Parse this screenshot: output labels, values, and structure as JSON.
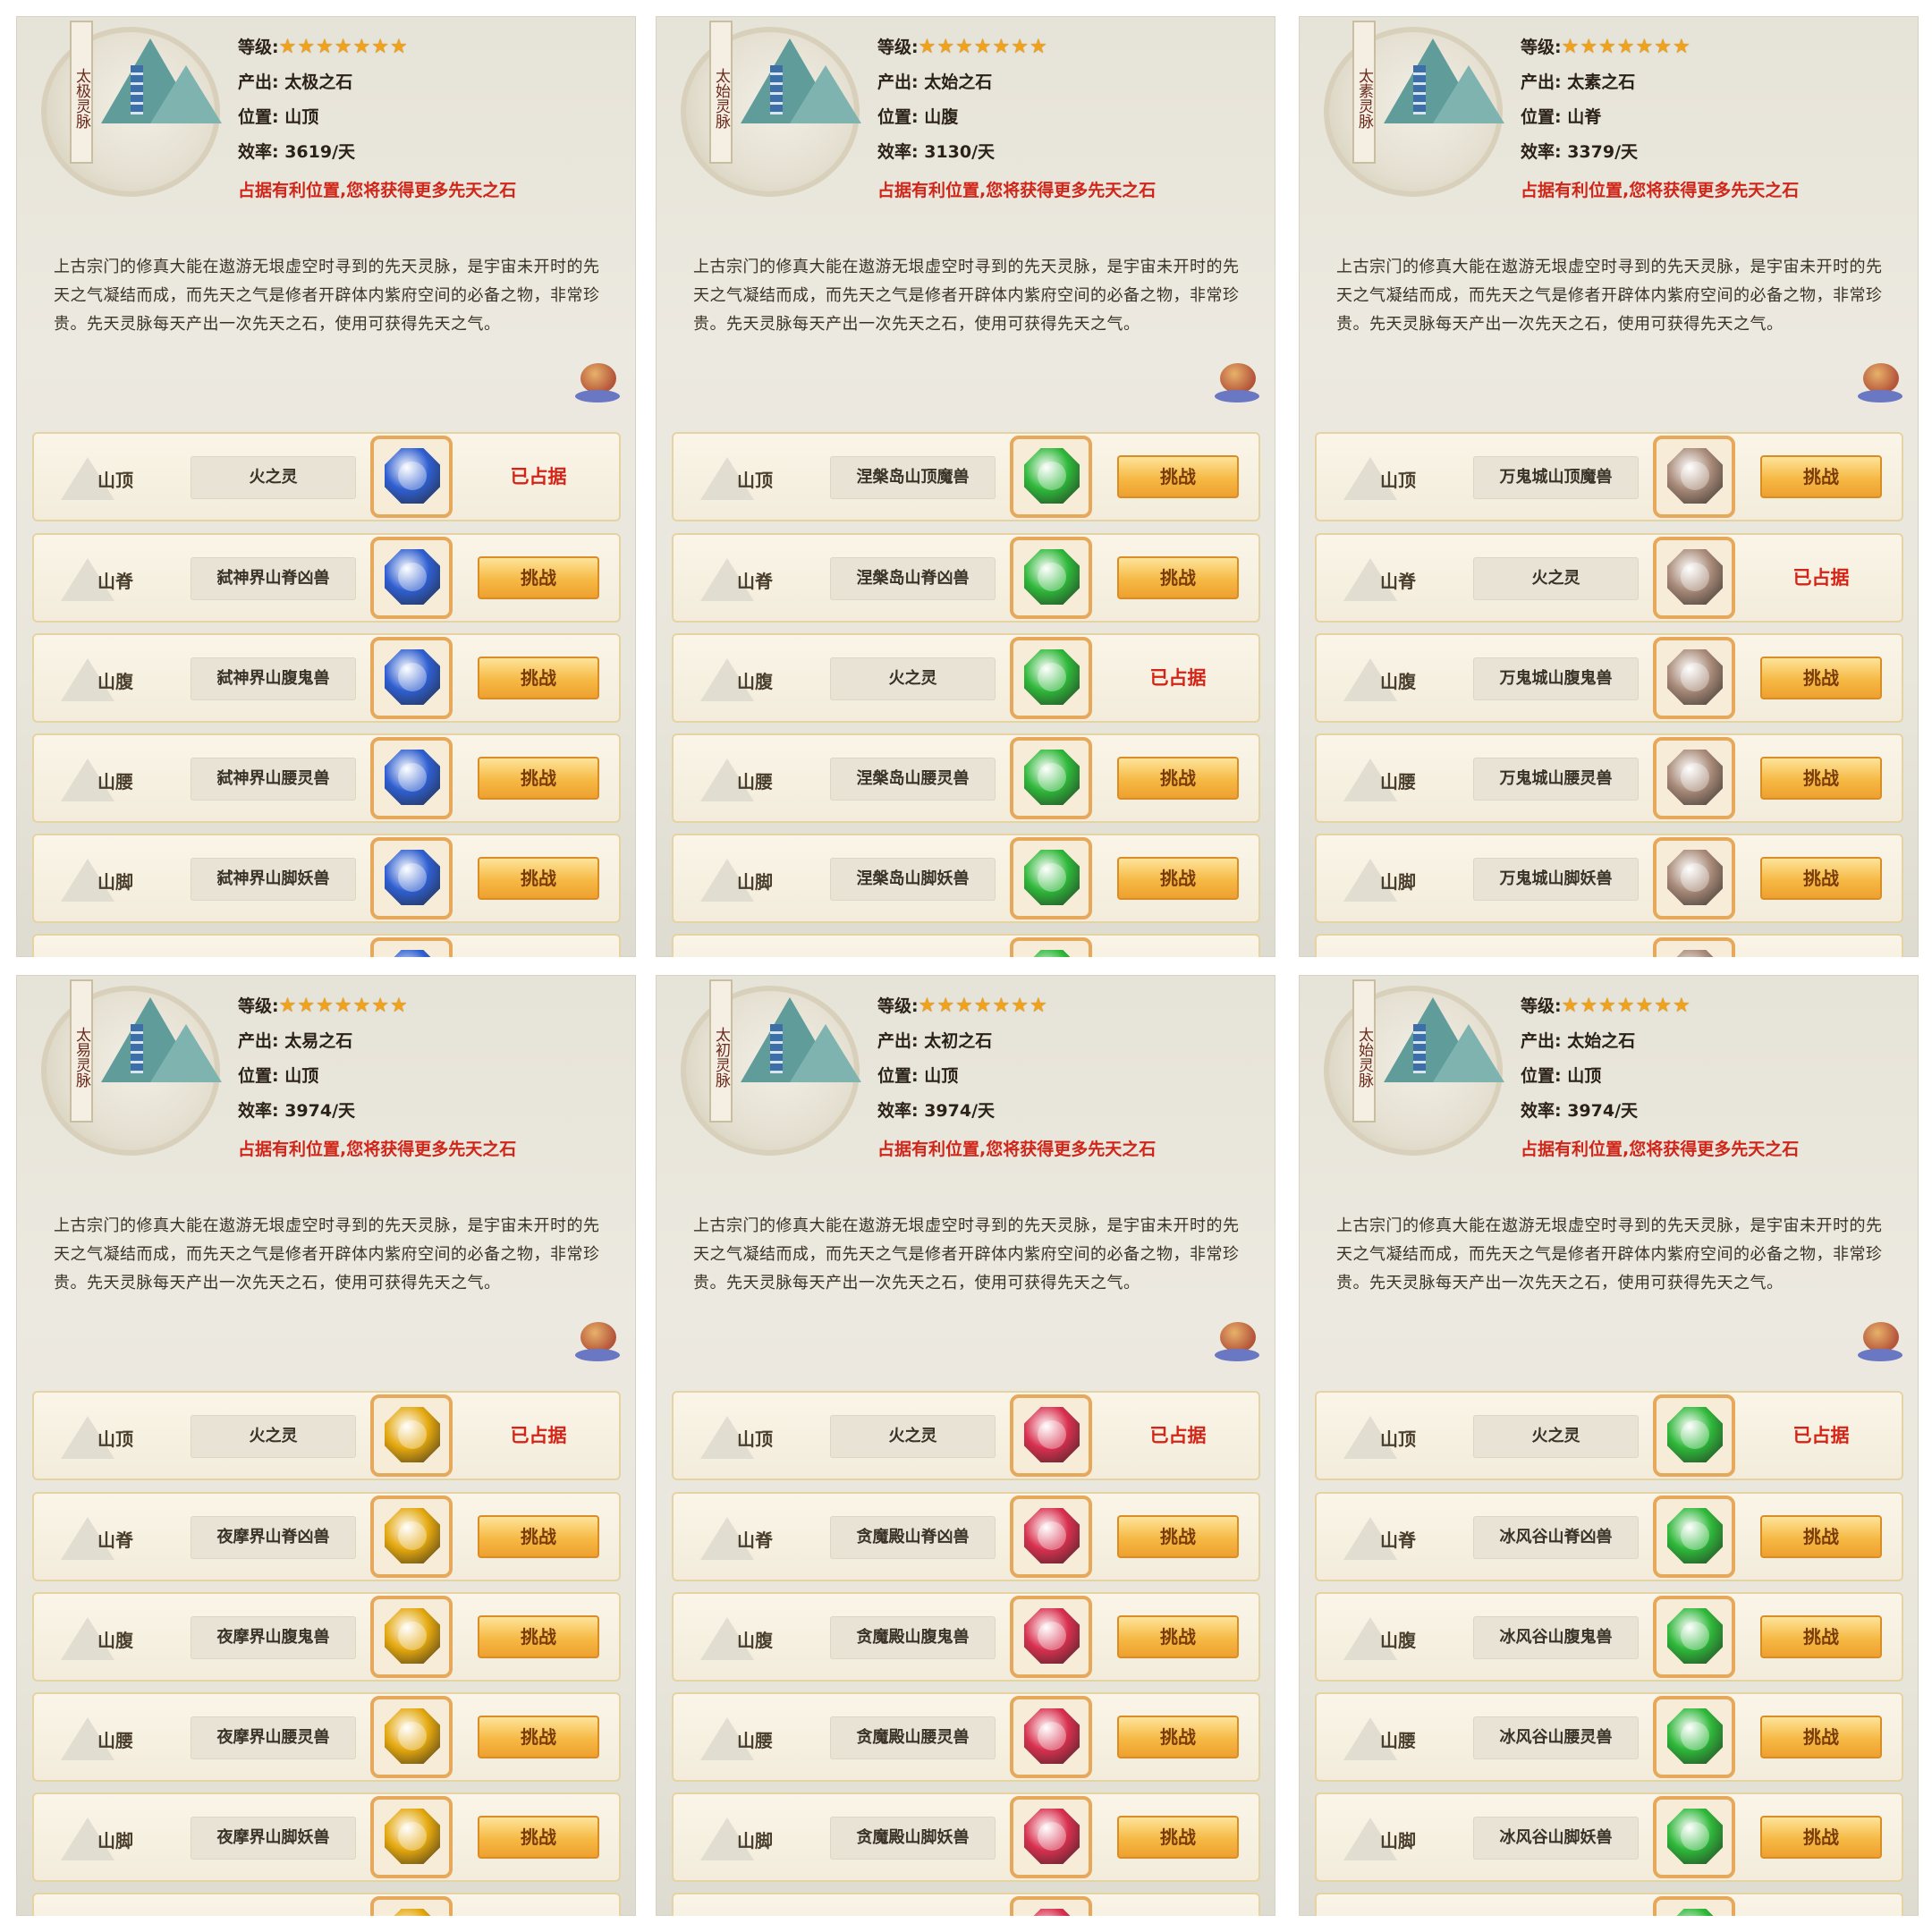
{
  "panels": [
    {
      "banner": "太极灵脉",
      "level_label": "等级:",
      "stars": "★★★★★★★",
      "output": "产出: 太极之石",
      "position": "位置: 山顶",
      "rate": "效率: 3619/天",
      "hint": "占据有利位置,您将获得更多先天之石",
      "description": "上古宗门的修真大能在遨游无垠虚空时寻到的先天灵脉，是宇宙未开时的先天之气凝结而成，而先天之气是修者开辟体内紫府空间的必备之物，非常珍贵。先天灵脉每天产出一次先天之石，使用可获得先天之气。",
      "gem_color": "#2f5fd0",
      "rows": [
        {
          "loc": "山顶",
          "name": "火之灵",
          "action": "已占据",
          "occupied": true
        },
        {
          "loc": "山脊",
          "name": "弑神界山脊凶兽",
          "action": "挑战",
          "occupied": false
        },
        {
          "loc": "山腹",
          "name": "弑神界山腹鬼兽",
          "action": "挑战",
          "occupied": false
        },
        {
          "loc": "山腰",
          "name": "弑神界山腰灵兽",
          "action": "挑战",
          "occupied": false
        },
        {
          "loc": "山脚",
          "name": "弑神界山脚妖兽",
          "action": "挑战",
          "occupied": false
        }
      ]
    },
    {
      "banner": "太始灵脉",
      "level_label": "等级:",
      "stars": "★★★★★★★",
      "output": "产出: 太始之石",
      "position": "位置: 山腹",
      "rate": "效率: 3130/天",
      "hint": "占据有利位置,您将获得更多先天之石",
      "description": "上古宗门的修真大能在遨游无垠虚空时寻到的先天灵脉，是宇宙未开时的先天之气凝结而成，而先天之气是修者开辟体内紫府空间的必备之物，非常珍贵。先天灵脉每天产出一次先天之石，使用可获得先天之气。",
      "gem_color": "#2fb83a",
      "rows": [
        {
          "loc": "山顶",
          "name": "涅槃岛山顶魔兽",
          "action": "挑战",
          "occupied": false
        },
        {
          "loc": "山脊",
          "name": "涅槃岛山脊凶兽",
          "action": "挑战",
          "occupied": false
        },
        {
          "loc": "山腹",
          "name": "火之灵",
          "action": "已占据",
          "occupied": true
        },
        {
          "loc": "山腰",
          "name": "涅槃岛山腰灵兽",
          "action": "挑战",
          "occupied": false
        },
        {
          "loc": "山脚",
          "name": "涅槃岛山脚妖兽",
          "action": "挑战",
          "occupied": false
        }
      ]
    },
    {
      "banner": "太素灵脉",
      "level_label": "等级:",
      "stars": "★★★★★★★",
      "output": "产出: 太素之石",
      "position": "位置: 山脊",
      "rate": "效率: 3379/天",
      "hint": "占据有利位置,您将获得更多先天之石",
      "description": "上古宗门的修真大能在遨游无垠虚空时寻到的先天灵脉，是宇宙未开时的先天之气凝结而成，而先天之气是修者开辟体内紫府空间的必备之物，非常珍贵。先天灵脉每天产出一次先天之石，使用可获得先天之气。",
      "gem_color": "#a88a78",
      "rows": [
        {
          "loc": "山顶",
          "name": "万鬼城山顶魔兽",
          "action": "挑战",
          "occupied": false
        },
        {
          "loc": "山脊",
          "name": "火之灵",
          "action": "已占据",
          "occupied": true
        },
        {
          "loc": "山腹",
          "name": "万鬼城山腹鬼兽",
          "action": "挑战",
          "occupied": false
        },
        {
          "loc": "山腰",
          "name": "万鬼城山腰灵兽",
          "action": "挑战",
          "occupied": false
        },
        {
          "loc": "山脚",
          "name": "万鬼城山脚妖兽",
          "action": "挑战",
          "occupied": false
        }
      ]
    },
    {
      "banner": "太易灵脉",
      "level_label": "等级:",
      "stars": "★★★★★★★",
      "output": "产出: 太易之石",
      "position": "位置: 山顶",
      "rate": "效率: 3974/天",
      "hint": "占据有利位置,您将获得更多先天之石",
      "description": "上古宗门的修真大能在遨游无垠虚空时寻到的先天灵脉，是宇宙未开时的先天之气凝结而成，而先天之气是修者开辟体内紫府空间的必备之物，非常珍贵。先天灵脉每天产出一次先天之石，使用可获得先天之气。",
      "gem_color": "#e4a80e",
      "rows": [
        {
          "loc": "山顶",
          "name": "火之灵",
          "action": "已占据",
          "occupied": true
        },
        {
          "loc": "山脊",
          "name": "夜摩界山脊凶兽",
          "action": "挑战",
          "occupied": false
        },
        {
          "loc": "山腹",
          "name": "夜摩界山腹鬼兽",
          "action": "挑战",
          "occupied": false
        },
        {
          "loc": "山腰",
          "name": "夜摩界山腰灵兽",
          "action": "挑战",
          "occupied": false
        },
        {
          "loc": "山脚",
          "name": "夜摩界山脚妖兽",
          "action": "挑战",
          "occupied": false
        }
      ]
    },
    {
      "banner": "太初灵脉",
      "level_label": "等级:",
      "stars": "★★★★★★★",
      "output": "产出: 太初之石",
      "position": "位置: 山顶",
      "rate": "效率: 3974/天",
      "hint": "占据有利位置,您将获得更多先天之石",
      "description": "上古宗门的修真大能在遨游无垠虚空时寻到的先天灵脉，是宇宙未开时的先天之气凝结而成，而先天之气是修者开辟体内紫府空间的必备之物，非常珍贵。先天灵脉每天产出一次先天之石，使用可获得先天之气。",
      "gem_color": "#d8304e",
      "rows": [
        {
          "loc": "山顶",
          "name": "火之灵",
          "action": "已占据",
          "occupied": true
        },
        {
          "loc": "山脊",
          "name": "贪魔殿山脊凶兽",
          "action": "挑战",
          "occupied": false
        },
        {
          "loc": "山腹",
          "name": "贪魔殿山腹鬼兽",
          "action": "挑战",
          "occupied": false
        },
        {
          "loc": "山腰",
          "name": "贪魔殿山腰灵兽",
          "action": "挑战",
          "occupied": false
        },
        {
          "loc": "山脚",
          "name": "贪魔殿山脚妖兽",
          "action": "挑战",
          "occupied": false
        }
      ]
    },
    {
      "banner": "太始灵脉",
      "level_label": "等级:",
      "stars": "★★★★★★★",
      "output": "产出: 太始之石",
      "position": "位置: 山顶",
      "rate": "效率: 3974/天",
      "hint": "占据有利位置,您将获得更多先天之石",
      "description": "上古宗门的修真大能在遨游无垠虚空时寻到的先天灵脉，是宇宙未开时的先天之气凝结而成，而先天之气是修者开辟体内紫府空间的必备之物，非常珍贵。先天灵脉每天产出一次先天之石，使用可获得先天之气。",
      "gem_color": "#2fb83a",
      "rows": [
        {
          "loc": "山顶",
          "name": "火之灵",
          "action": "已占据",
          "occupied": true
        },
        {
          "loc": "山脊",
          "name": "冰风谷山脊凶兽",
          "action": "挑战",
          "occupied": false
        },
        {
          "loc": "山腹",
          "name": "冰风谷山腹鬼兽",
          "action": "挑战",
          "occupied": false
        },
        {
          "loc": "山腰",
          "name": "冰风谷山腰灵兽",
          "action": "挑战",
          "occupied": false
        },
        {
          "loc": "山脚",
          "name": "冰风谷山脚妖兽",
          "action": "挑战",
          "occupied": false
        }
      ]
    }
  ]
}
